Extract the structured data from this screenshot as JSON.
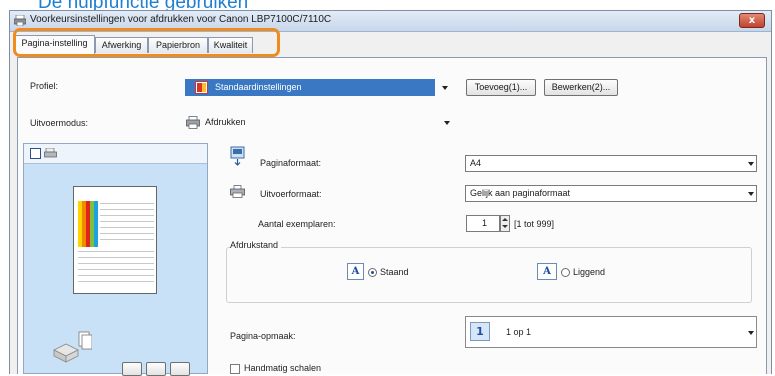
{
  "page_heading": "De hulpfunctie gebruiken",
  "window": {
    "title": "Voorkeursinstellingen voor afdrukken voor Canon LBP7100C/7110C",
    "close_label": "x"
  },
  "tabs": [
    {
      "label": "Pagina-instelling",
      "active": true
    },
    {
      "label": "Afwerking",
      "active": false
    },
    {
      "label": "Papierbron",
      "active": false
    },
    {
      "label": "Kwaliteit",
      "active": false
    }
  ],
  "profile": {
    "label": "Profiel:",
    "value": "Standaardinstellingen",
    "add_button": "Toevoeg(1)...",
    "edit_button": "Bewerken(2)..."
  },
  "output_mode": {
    "label": "Uitvoermodus:",
    "value": "Afdrukken"
  },
  "page_size": {
    "label": "Paginaformaat:",
    "value": "A4"
  },
  "output_size": {
    "label": "Uitvoerformaat:",
    "value": "Gelijk aan paginaformaat"
  },
  "copies": {
    "label": "Aantal exemplaren:",
    "value": "1",
    "range": "[1 tot 999]"
  },
  "orientation": {
    "label": "Afdrukstand",
    "portrait_label": "Staand",
    "landscape_label": "Liggend",
    "selected": "portrait",
    "icon_glyph": "A"
  },
  "page_layout": {
    "label": "Pagina-opmaak:",
    "value": "1 op 1",
    "icon_number": "1"
  },
  "manual_scaling": {
    "label": "Handmatig schalen",
    "checked": false
  },
  "colors": {
    "heading_blue": "#1f7fd1",
    "highlight_orange": "#f08b1e",
    "selection_blue": "#3a78c4",
    "preview_bg": "#c9e1f6"
  }
}
